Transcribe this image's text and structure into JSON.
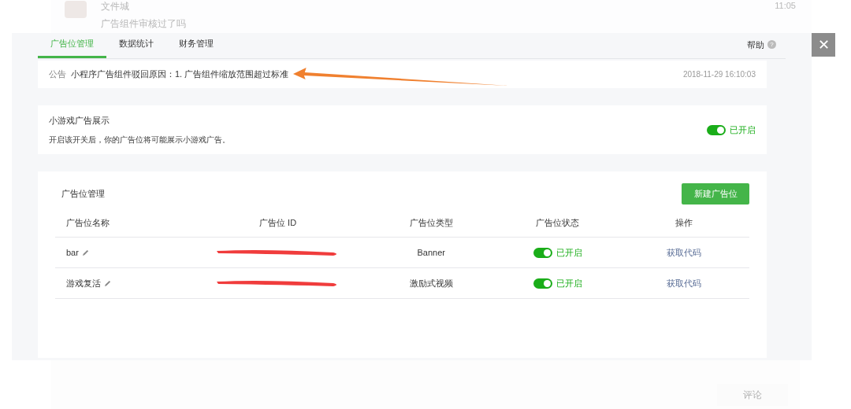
{
  "background_post": {
    "author": "文件城",
    "message": "广告组件审核过了吗",
    "time": "11:05",
    "comment_button": "评论"
  },
  "tabs": [
    {
      "label": "广告位管理",
      "selected": true
    },
    {
      "label": "数据统计",
      "selected": false
    },
    {
      "label": "财务管理",
      "selected": false
    }
  ],
  "help": {
    "label": "帮助",
    "icon": "?"
  },
  "close_button": "✕",
  "notice": {
    "tag": "公告",
    "text": "小程序广告组件驳回原因：1. 广告组件缩放范围超过标准",
    "time": "2018-11-29 16:10:03"
  },
  "minigame_ads": {
    "title": "小游戏广告展示",
    "description": "开启该开关后，你的广告位将可能展示小游戏广告。",
    "on": true,
    "status": "已开启"
  },
  "ad_slots": {
    "title": "广告位管理",
    "new_button": "新建广告位",
    "columns": [
      "广告位名称",
      "广告位 ID",
      "广告位类型",
      "广告位状态",
      "操作"
    ],
    "rows": [
      {
        "name": "bar",
        "type": "Banner",
        "on": true,
        "status": "已开启",
        "action": "获取代码"
      },
      {
        "name": "游戏复活",
        "type": "激励式视频",
        "on": true,
        "status": "已开启",
        "action": "获取代码"
      }
    ]
  }
}
